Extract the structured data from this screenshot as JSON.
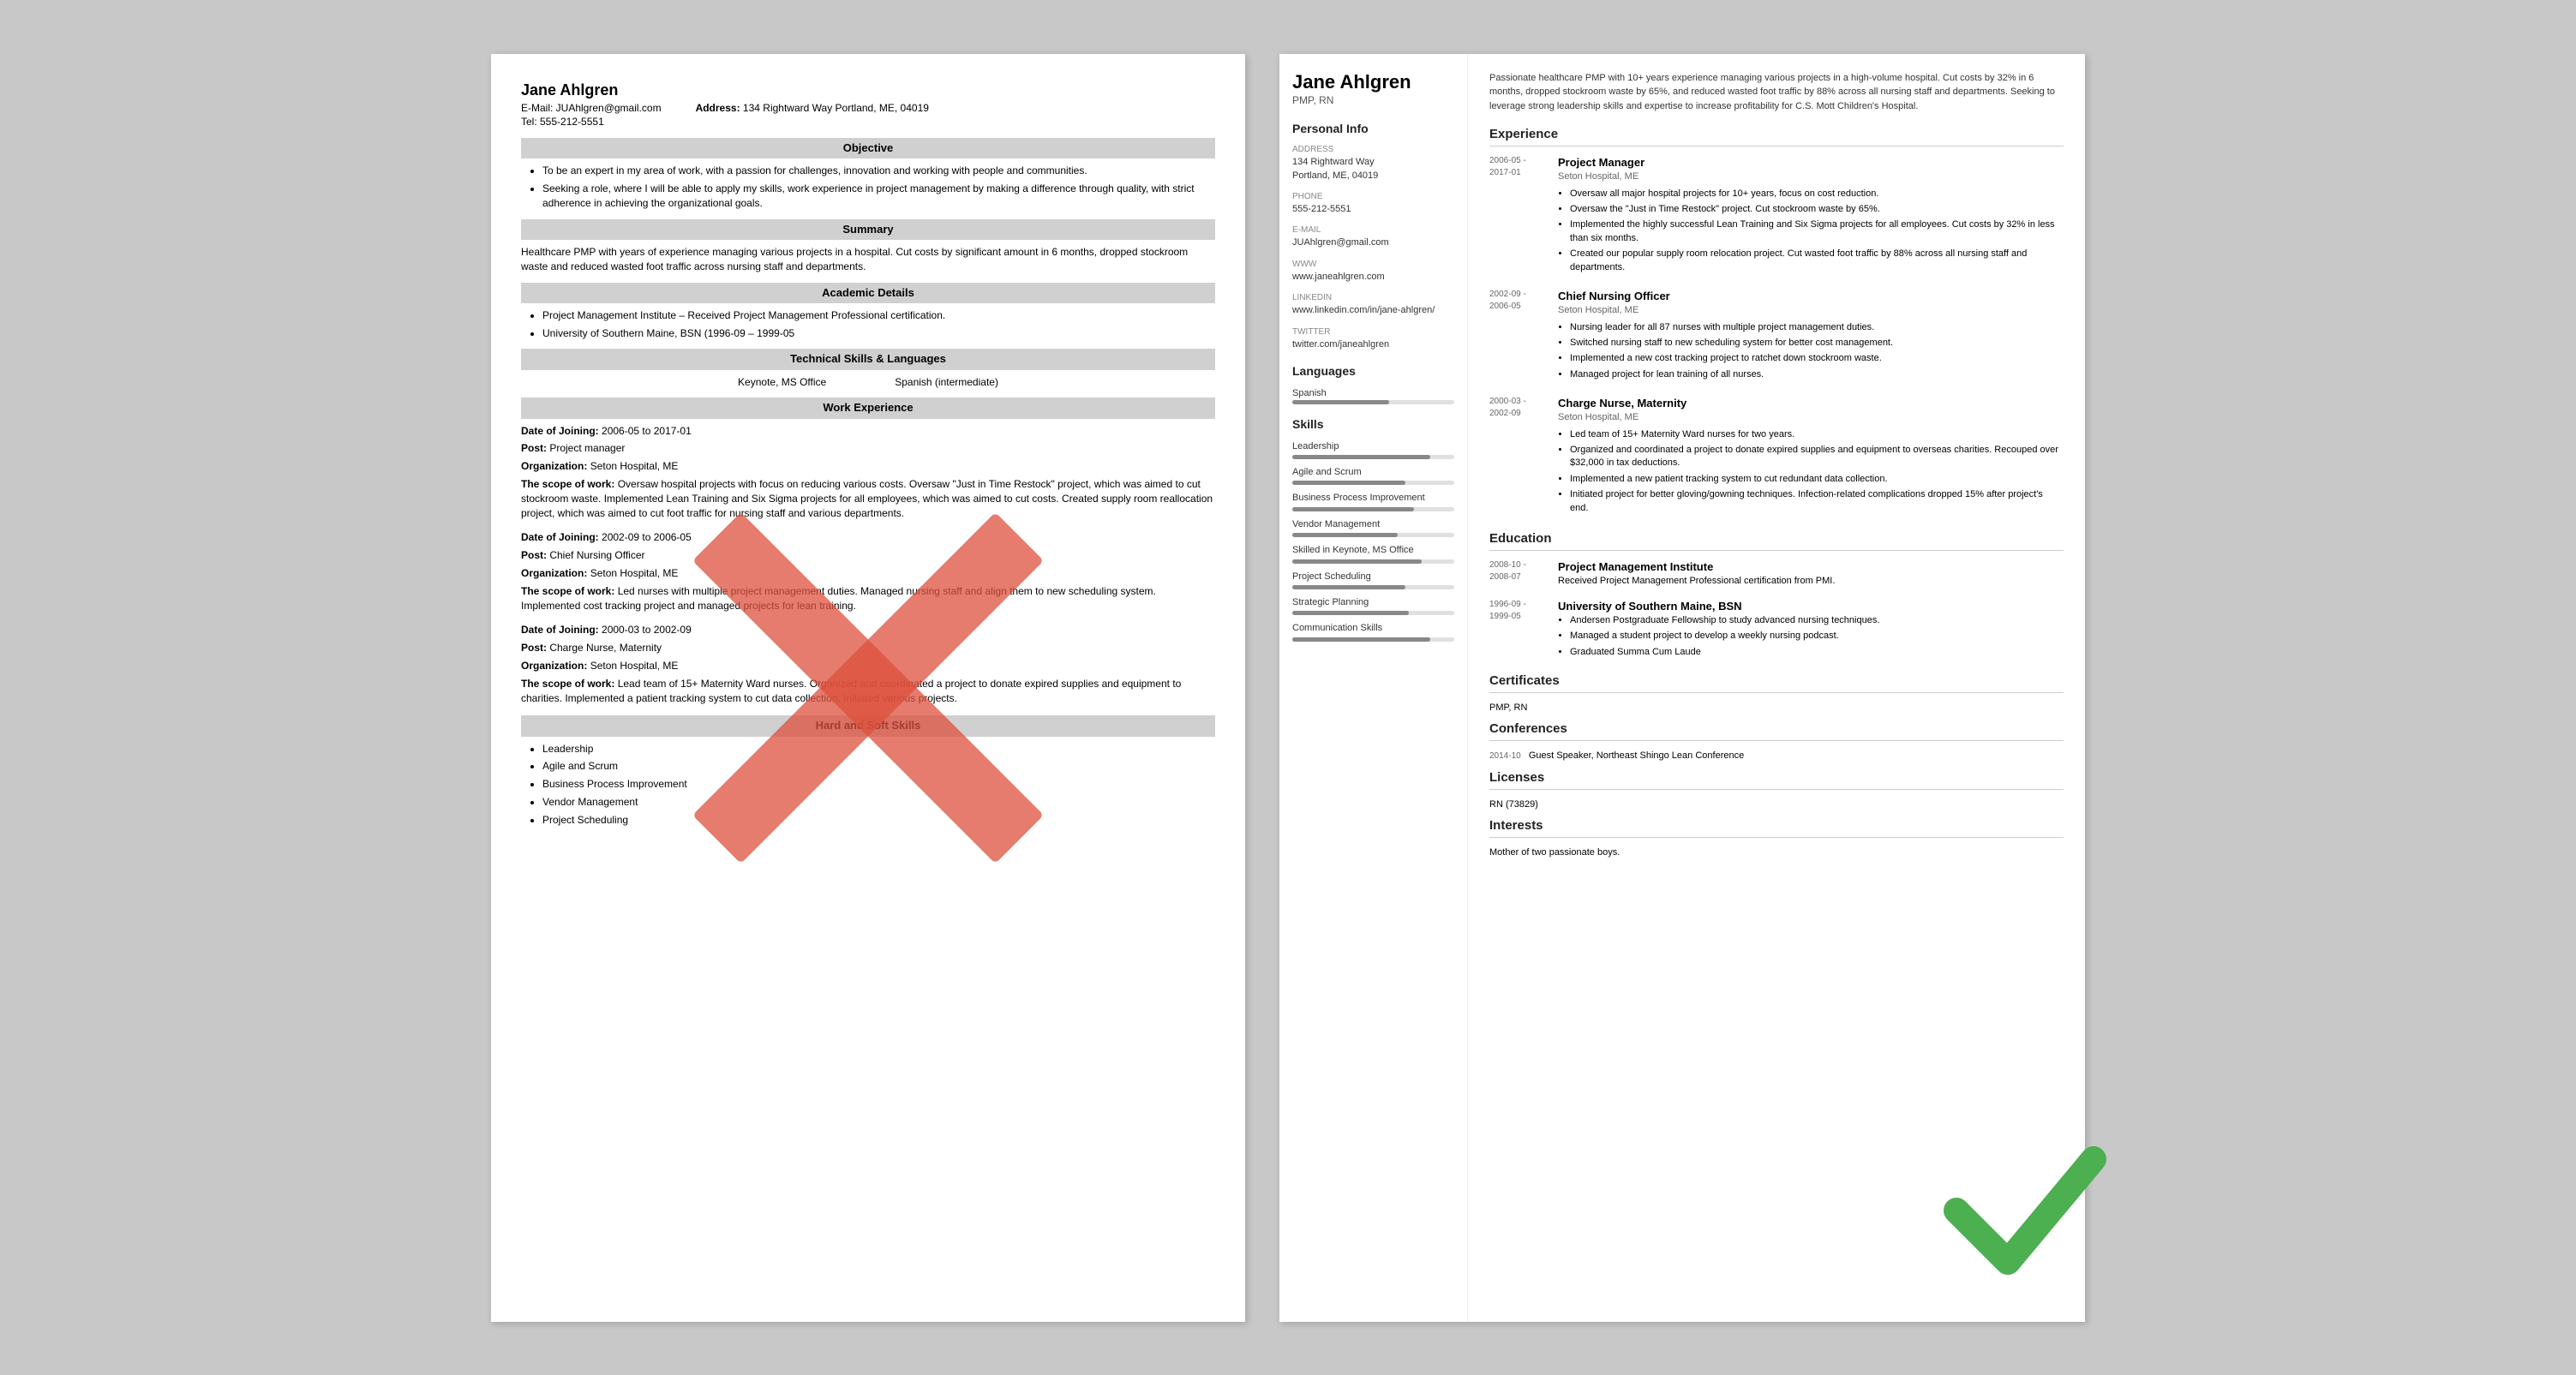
{
  "left_resume": {
    "name": "Jane Ahlgren",
    "contact1": "E-Mail: JUAhlgren@gmail.com",
    "contact2": "Tel: 555-212-5551",
    "address_label": "Address:",
    "address_val": "134 Rightward Way Portland, ME, 04019",
    "sections": {
      "objective": {
        "header": "Objective",
        "bullets": [
          "To be an expert in my area of work, with a passion for challenges, innovation and working with people and communities.",
          "Seeking a role, where I will be able to apply my skills, work experience in project management by making a difference through quality, with strict adherence in achieving the organizational goals."
        ]
      },
      "summary": {
        "header": "Summary",
        "text": "Healthcare PMP with years of experience managing various projects in a hospital. Cut costs by significant amount in 6 months, dropped stockroom waste and reduced wasted foot traffic across nursing staff and departments."
      },
      "academic": {
        "header": "Academic Details",
        "bullets": [
          "Project Management Institute – Received Project Management Professional certification.",
          "University of Southern Maine, BSN (1996-09 – 1999-05"
        ]
      },
      "tech_skills": {
        "header": "Technical Skills & Languages",
        "skill1": "Keynote, MS Office",
        "skill2": "Spanish (intermediate)"
      },
      "work": {
        "header": "Work Experience",
        "entries": [
          {
            "date_label": "Date of Joining:",
            "date": "2006-05 to 2017-01",
            "post_label": "Post:",
            "post": "Project manager",
            "org_label": "Organization:",
            "org": "Seton Hospital, ME",
            "scope_label": "The scope of work:",
            "scope": "Oversaw hospital projects with focus on reducing various costs. Oversaw \"Just in Time Restock\" project, which was aimed to cut stockroom waste. Implemented Lean Training and Six Sigma projects for all employees, which was aimed to cut costs. Created supply room reallocation project, which was aimed to cut foot traffic for nursing staff and various departments."
          },
          {
            "date_label": "Date of Joining:",
            "date": "2002-09 to 2006-05",
            "post_label": "Post:",
            "post": "Chief Nursing Officer",
            "org_label": "Organization:",
            "org": "Seton Hospital, ME",
            "scope_label": "The scope of work:",
            "scope": "Led nurses with multiple project management duties. Managed nursing staff and align them to new scheduling system. Implemented cost tracking project and managed projects for lean training."
          },
          {
            "date_label": "Date of Joining:",
            "date": "2000-03 to 2002-09",
            "post_label": "Post:",
            "post": "Charge Nurse, Maternity",
            "org_label": "Organization:",
            "org": "Seton Hospital, ME",
            "scope_label": "The scope of work:",
            "scope": "Lead team of 15+ Maternity Ward nurses. Organized and coordinated a project to donate expired supplies and equipment to charities. Implemented a patient tracking system to cut data collection. Initiated various projects."
          }
        ]
      },
      "hard_soft": {
        "header": "Hard and Soft Skills",
        "bullets": [
          "Leadership",
          "Agile and Scrum",
          "Business Process Improvement",
          "Vendor Management",
          "Project Scheduling"
        ]
      }
    }
  },
  "right_resume": {
    "name": "Jane Ahlgren",
    "title": "PMP, RN",
    "summary": "Passionate healthcare PMP with 10+ years experience managing various projects in a high-volume hospital. Cut costs by 32% in 6 months, dropped stockroom waste by 65%, and reduced wasted foot traffic by 88% across all nursing staff and departments. Seeking to leverage strong leadership skills and expertise to increase profitability for C.S. Mott Children's Hospital.",
    "sidebar": {
      "personal_info_title": "Personal Info",
      "address_label": "Address",
      "address": "134 Rightward Way\nPortland, ME, 04019",
      "phone_label": "Phone",
      "phone": "555-212-5551",
      "email_label": "E-mail",
      "email": "JUAhlgren@gmail.com",
      "www_label": "www",
      "www": "www.janeahlgren.com",
      "linkedin_label": "LinkedIn",
      "linkedin": "www.linkedin.com/in/jane-ahlgren/",
      "twitter_label": "Twitter",
      "twitter": "twitter.com/janeahlgren",
      "languages_title": "Languages",
      "language1": "Spanish",
      "skills_title": "Skills",
      "skills": [
        {
          "name": "Leadership",
          "level": 85
        },
        {
          "name": "Agile and Scrum",
          "level": 70
        },
        {
          "name": "Business Process Improvement",
          "level": 75
        },
        {
          "name": "Vendor Management",
          "level": 65
        },
        {
          "name": "Skilled in Keynote, MS Office",
          "level": 80
        },
        {
          "name": "Project Scheduling",
          "level": 70
        },
        {
          "name": "Strategic Planning",
          "level": 72
        },
        {
          "name": "Communication Skills",
          "level": 85
        }
      ]
    },
    "experience": {
      "title": "Experience",
      "entries": [
        {
          "dates": "2006-05 -\n2017-01",
          "title": "Project Manager",
          "org": "Seton Hospital, ME",
          "bullets": [
            "Oversaw all major hospital projects for 10+ years, focus on cost reduction.",
            "Oversaw the \"Just in Time Restock\" project. Cut stockroom waste by 65%.",
            "Implemented the highly successful Lean Training and Six Sigma projects for all employees. Cut costs by 32% in less than six months.",
            "Created our popular supply room relocation project. Cut wasted foot traffic by 88% across all nursing staff and departments."
          ]
        },
        {
          "dates": "2002-09 -\n2006-05",
          "title": "Chief Nursing Officer",
          "org": "Seton Hospital, ME",
          "bullets": [
            "Nursing leader for all 87 nurses with multiple project management duties.",
            "Switched nursing staff to new scheduling system for better cost management.",
            "Implemented a new cost tracking project to ratchet down stockroom waste.",
            "Managed project for lean training of all nurses."
          ]
        },
        {
          "dates": "2000-03 -\n2002-09",
          "title": "Charge Nurse, Maternity",
          "org": "Seton Hospital, ME",
          "bullets": [
            "Led team of 15+ Maternity Ward nurses for two years.",
            "Organized and coordinated a project to donate expired supplies and equipment to overseas charities. Recouped over $32,000 in tax deductions.",
            "Implemented a new patient tracking system to cut redundant data collection.",
            "Initiated project for better gloving/gowning techniques. Infection-related complications dropped 15% after project's end."
          ]
        }
      ]
    },
    "education": {
      "title": "Education",
      "entries": [
        {
          "dates": "2008-10 -\n2008-07",
          "school": "Project Management Institute",
          "details": "Received Project Management Professional certification from PMI."
        },
        {
          "dates": "1996-09 -\n1999-05",
          "school": "University of Southern Maine, BSN",
          "bullets": [
            "Andersen Postgraduate Fellowship to study advanced nursing techniques.",
            "Managed a student project to develop a weekly nursing podcast.",
            "Graduated Summa Cum Laude"
          ]
        }
      ]
    },
    "certificates": {
      "title": "Certificates",
      "items": [
        "PMP, RN"
      ]
    },
    "conferences": {
      "title": "Conferences",
      "entries": [
        {
          "date": "2014-10",
          "name": "Guest Speaker, Northeast Shingo Lean Conference"
        }
      ]
    },
    "licenses": {
      "title": "Licenses",
      "items": [
        "RN (73829)"
      ]
    },
    "interests": {
      "title": "Interests",
      "items": [
        "Mother of two passionate boys."
      ]
    }
  }
}
